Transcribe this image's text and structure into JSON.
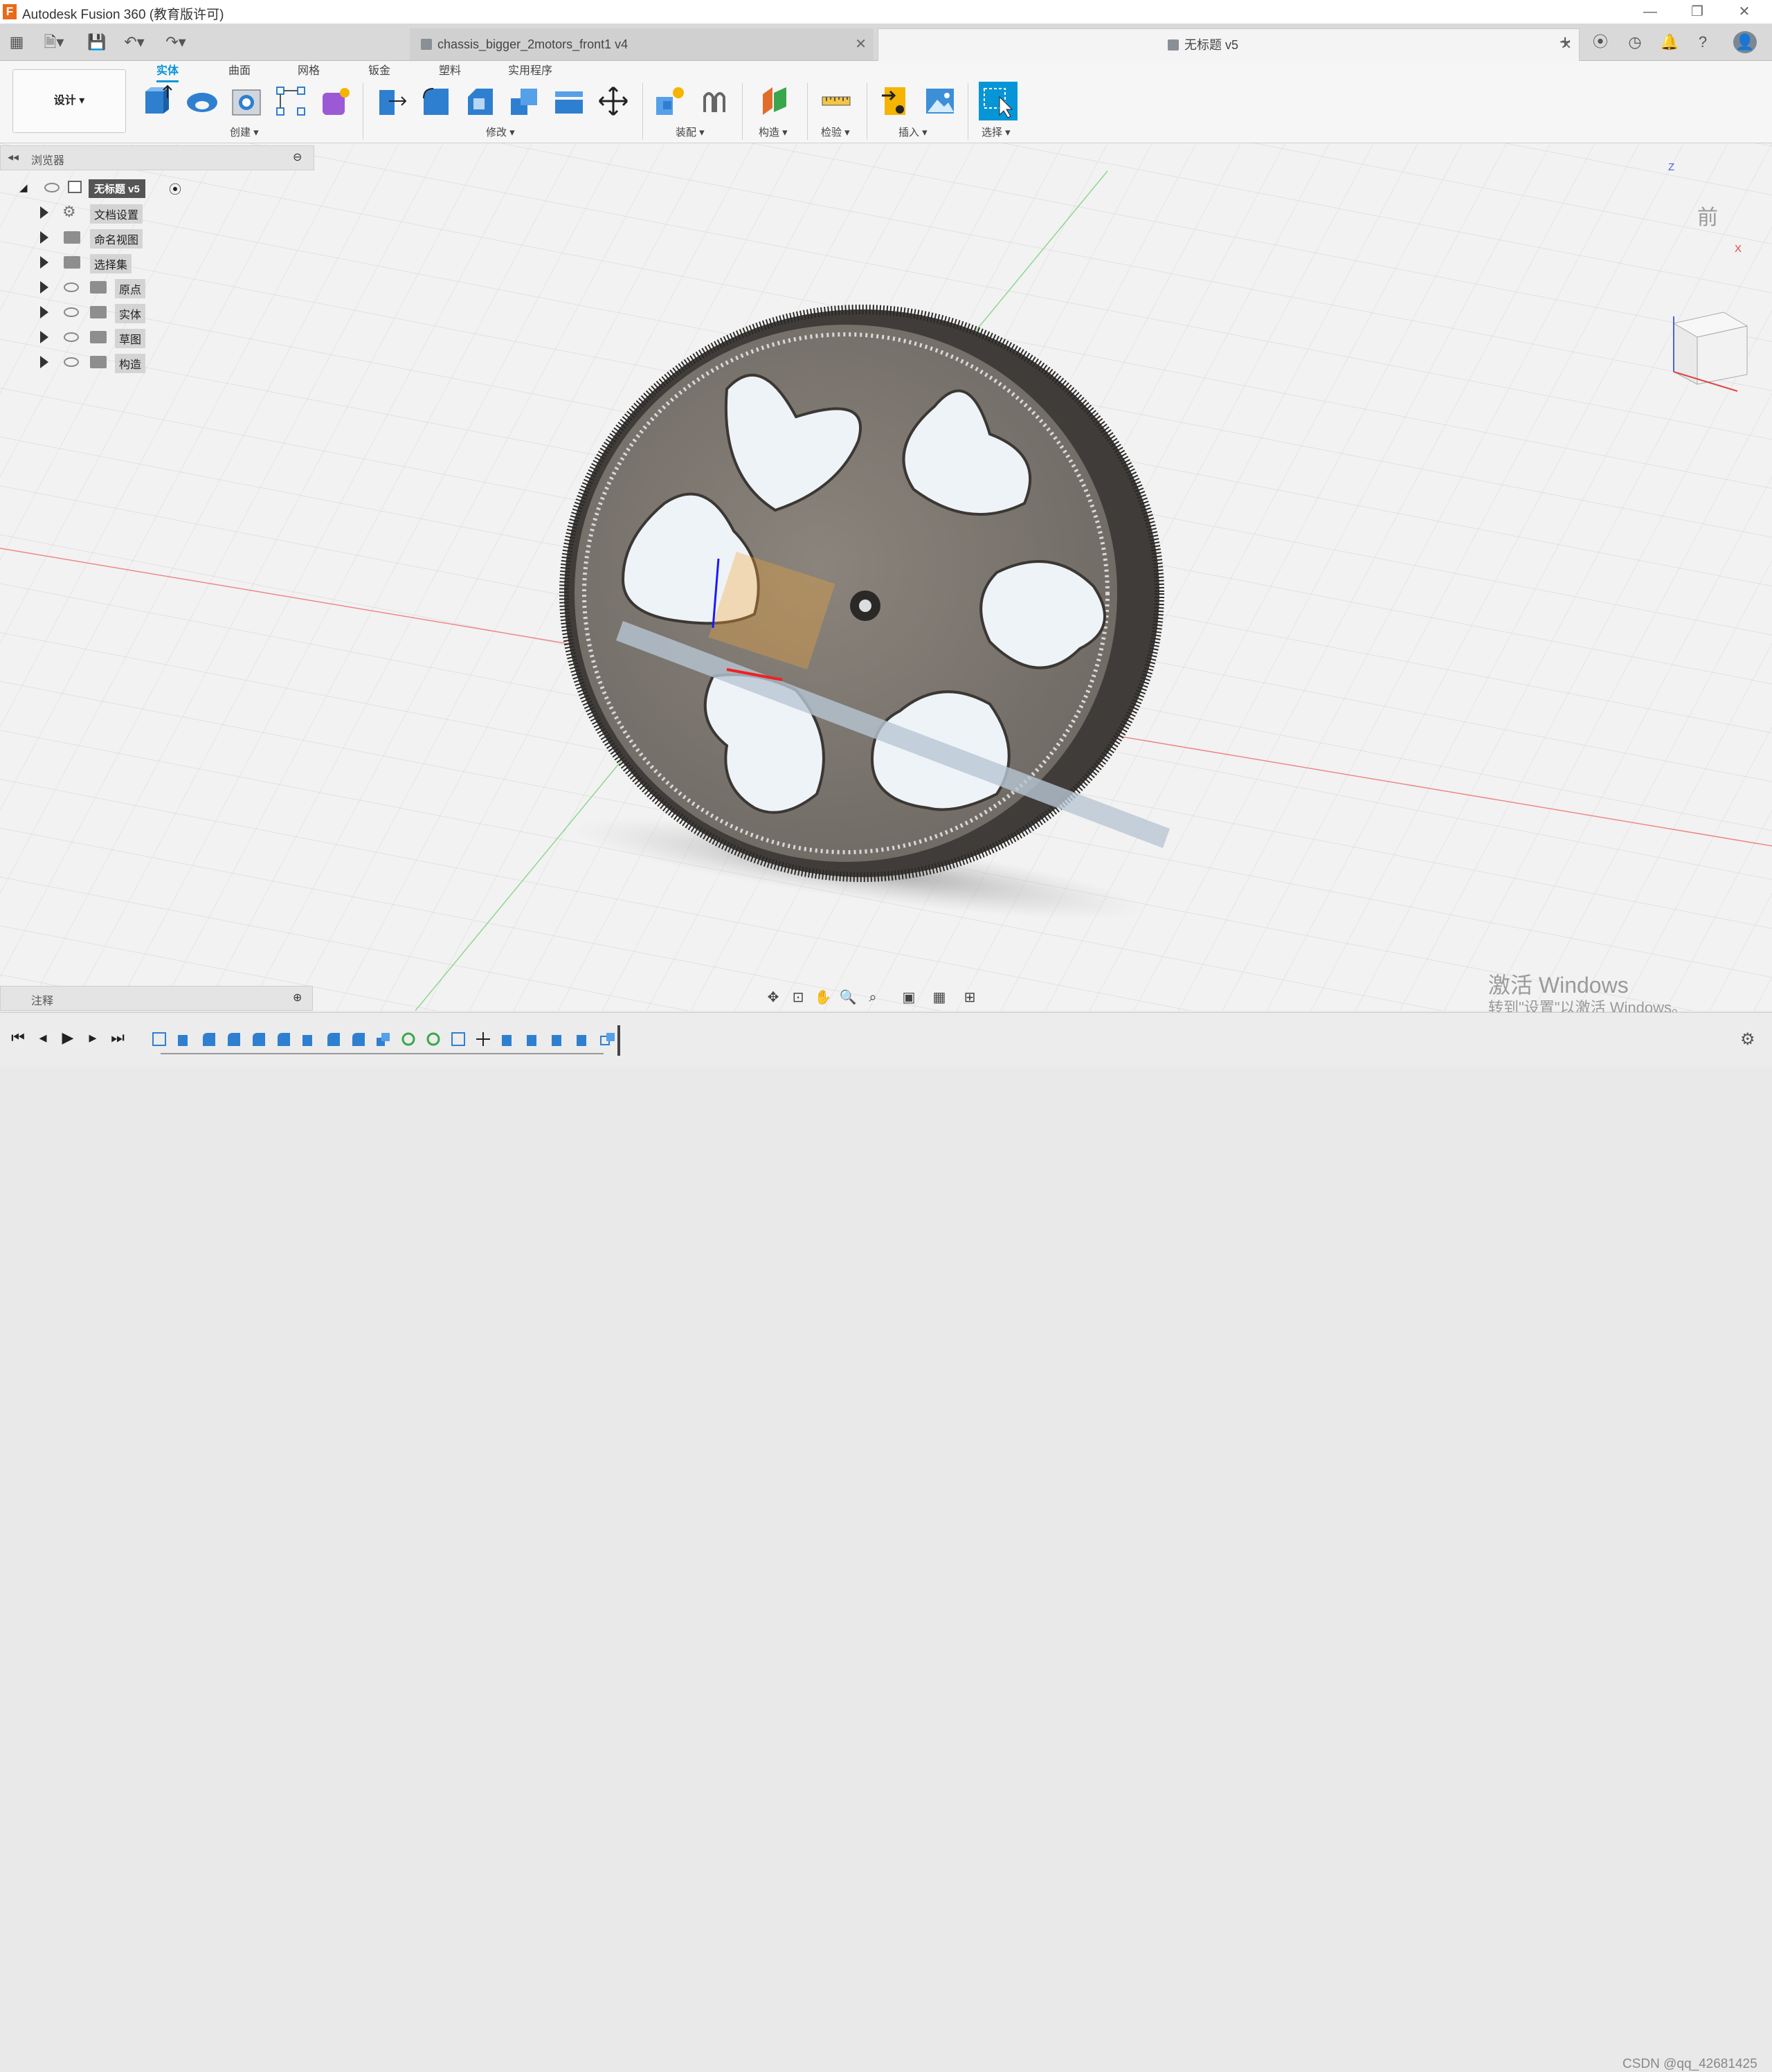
{
  "window": {
    "title": "Autodesk Fusion 360 (教育版许可)",
    "controls": {
      "minimize": "—",
      "restore": "❐",
      "close": "✕"
    }
  },
  "tabs": [
    {
      "label": "chassis_bigger_2motors_front1 v4",
      "active": false
    },
    {
      "label": "无标题 v5",
      "active": true
    }
  ],
  "toolbar": {
    "workspace": "设计 ▾",
    "ribbon_tabs": [
      "实体",
      "曲面",
      "网格",
      "钣金",
      "塑料",
      "实用程序"
    ],
    "groups": [
      "创建 ▾",
      "修改 ▾",
      "装配 ▾",
      "构造 ▾",
      "检验 ▾",
      "插入 ▾",
      "选择 ▾"
    ]
  },
  "browser": {
    "title": "浏览器",
    "root": "无标题 v5",
    "items": [
      {
        "label": "文档设置",
        "icon": "gear-icon",
        "visible_toggle": false
      },
      {
        "label": "命名视图",
        "icon": "folder-icon",
        "visible_toggle": false
      },
      {
        "label": "选择集",
        "icon": "folder-icon",
        "visible_toggle": false
      },
      {
        "label": "原点",
        "icon": "folder-icon",
        "visible_toggle": true
      },
      {
        "label": "实体",
        "icon": "folder-icon",
        "visible_toggle": true
      },
      {
        "label": "草图",
        "icon": "folder-icon",
        "visible_toggle": true
      },
      {
        "label": "构造",
        "icon": "folder-icon",
        "visible_toggle": true
      }
    ]
  },
  "viewcube": {
    "face": "前",
    "axis_z": "Z",
    "axis_x": "X"
  },
  "comments": {
    "title": "注释"
  },
  "watermark": {
    "line1": "激活 Windows",
    "line2": "转到\"设置\"以激活 Windows。"
  },
  "credit": "CSDN @qq_42681425",
  "colors": {
    "accent": "#0696d7",
    "model_body": "#7a7670",
    "grid_line": "#d6d6d6",
    "x_axis": "#e06060",
    "y_axis": "#7ad07a"
  }
}
